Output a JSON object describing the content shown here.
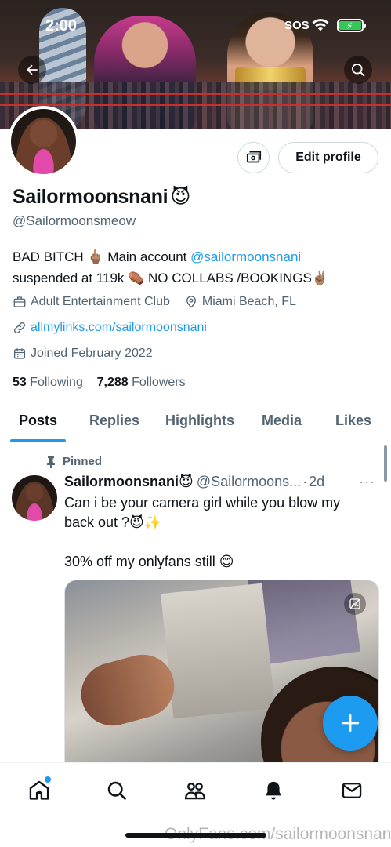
{
  "status_bar": {
    "time": "2:00",
    "sos": "SOS"
  },
  "profile": {
    "display_name": "Sailormoonsnani",
    "name_emoji": "😈",
    "handle": "@Sailormoonsmeow",
    "bio_line1_pre": "BAD BITCH 🖕🏽 Main account ",
    "bio_mention": "@sailormoonsnani",
    "bio_line2": "suspended at 119k ⚰️ NO COLLABS /BOOKINGS✌🏽",
    "category": "Adult Entertainment Club",
    "location": "Miami Beach, FL",
    "website": "allmylinks.com/sailormoonsnani",
    "joined": "Joined February 2022",
    "following_count": "53",
    "following_label": "Following",
    "followers_count": "7,288",
    "followers_label": "Followers",
    "edit_profile_label": "Edit profile"
  },
  "tabs": [
    "Posts",
    "Replies",
    "Highlights",
    "Media",
    "Likes"
  ],
  "active_tab": "Posts",
  "pinned_tweet": {
    "pinned_label": "Pinned",
    "author_name": "Sailormoonsnani",
    "author_emoji": "😈",
    "author_handle": "@Sailormoons...",
    "separator": "·",
    "time": "2d",
    "more": "···",
    "text_line1": "Can i be your camera girl while you blow my",
    "text_line2": "back out ?😈✨",
    "text_line3": "30% off my onlyfans still 😊"
  },
  "watermark": "OnlyFans.com/sailormoonsnani",
  "colors": {
    "accent": "#1d9bf0",
    "text": "#0f1419",
    "muted": "#536471",
    "border": "#cfd9de"
  },
  "icons": [
    "back-arrow-icon",
    "search-icon",
    "money-icon",
    "briefcase-icon",
    "location-pin-icon",
    "link-icon",
    "calendar-icon",
    "pin-icon",
    "media-sensitive-icon",
    "plus-icon",
    "home-icon",
    "explore-icon",
    "communities-icon",
    "notifications-icon",
    "messages-icon"
  ]
}
